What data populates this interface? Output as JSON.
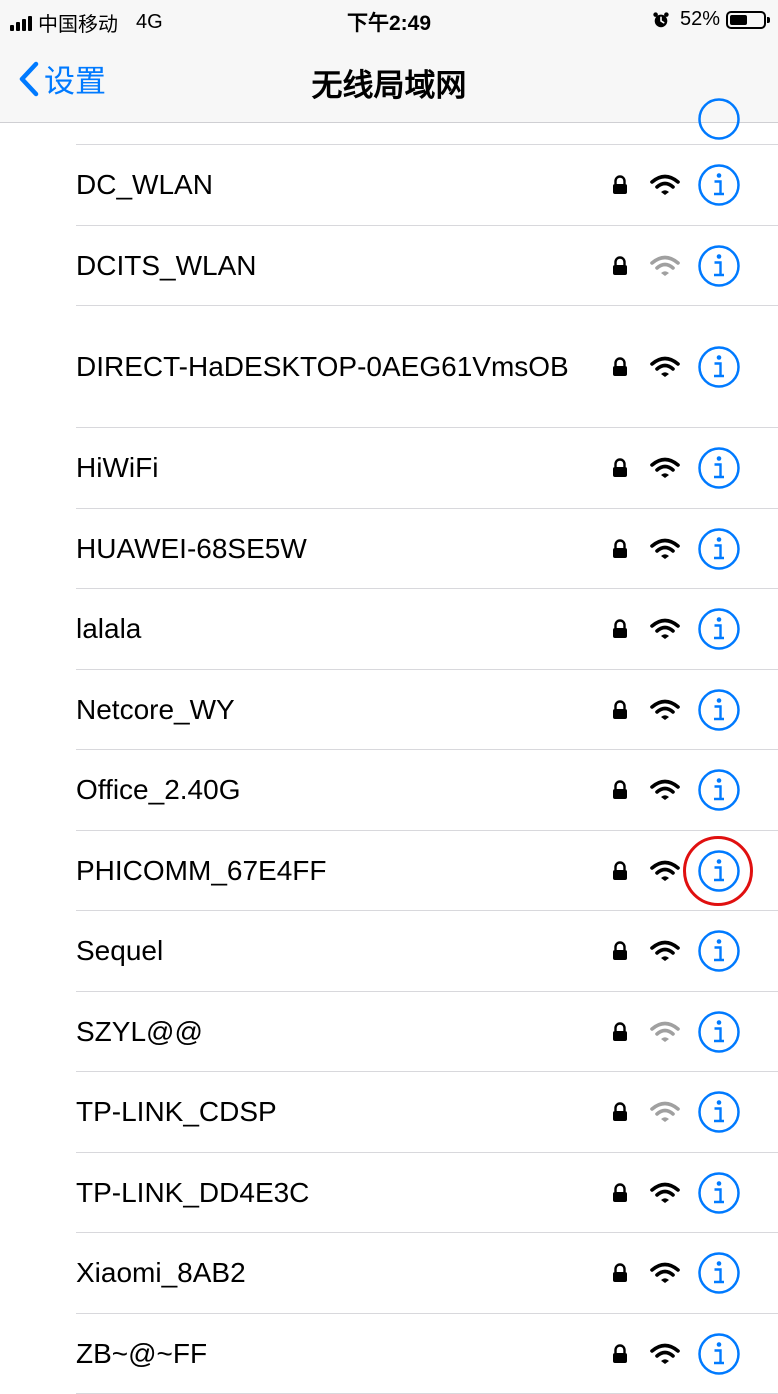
{
  "status_bar": {
    "carrier": "中国移动",
    "network": "4G",
    "time": "下午2:49",
    "battery_text": "52%",
    "battery_level": 0.52,
    "icons": [
      "signal-bars-icon",
      "alarm-clock-icon",
      "battery-icon"
    ]
  },
  "nav": {
    "back_label": "设置",
    "title": "无线局域网",
    "icons": [
      "chevron-left-icon"
    ]
  },
  "networks": [
    {
      "ssid": "DC_WLAN",
      "secured": true,
      "signal": "strong"
    },
    {
      "ssid": "DCITS_WLAN",
      "secured": true,
      "signal": "weak"
    },
    {
      "ssid": "DIRECT-HaDESKTOP-0AEG61VmsOB",
      "secured": true,
      "signal": "strong"
    },
    {
      "ssid": "HiWiFi",
      "secured": true,
      "signal": "strong"
    },
    {
      "ssid": "HUAWEI-68SE5W",
      "secured": true,
      "signal": "strong"
    },
    {
      "ssid": "lalala",
      "secured": true,
      "signal": "strong"
    },
    {
      "ssid": "Netcore_WY",
      "secured": true,
      "signal": "strong"
    },
    {
      "ssid": "Office_2.40G",
      "secured": true,
      "signal": "strong"
    },
    {
      "ssid": "PHICOMM_67E4FF",
      "secured": true,
      "signal": "strong",
      "highlighted": true
    },
    {
      "ssid": "Sequel",
      "secured": true,
      "signal": "strong"
    },
    {
      "ssid": "SZYL@@",
      "secured": true,
      "signal": "weak"
    },
    {
      "ssid": "TP-LINK_CDSP",
      "secured": true,
      "signal": "weak"
    },
    {
      "ssid": "TP-LINK_DD4E3C",
      "secured": true,
      "signal": "strong"
    },
    {
      "ssid": "Xiaomi_8AB2",
      "secured": true,
      "signal": "strong"
    },
    {
      "ssid": "ZB~@~FF",
      "secured": true,
      "signal": "strong"
    }
  ],
  "row_icons": [
    "lock-icon",
    "wifi-signal-icon",
    "info-button-icon"
  ],
  "colors": {
    "accent": "#007aff",
    "highlight": "#e01010",
    "wifi_strong": "#000000",
    "wifi_weak": "#a0a0a0"
  }
}
